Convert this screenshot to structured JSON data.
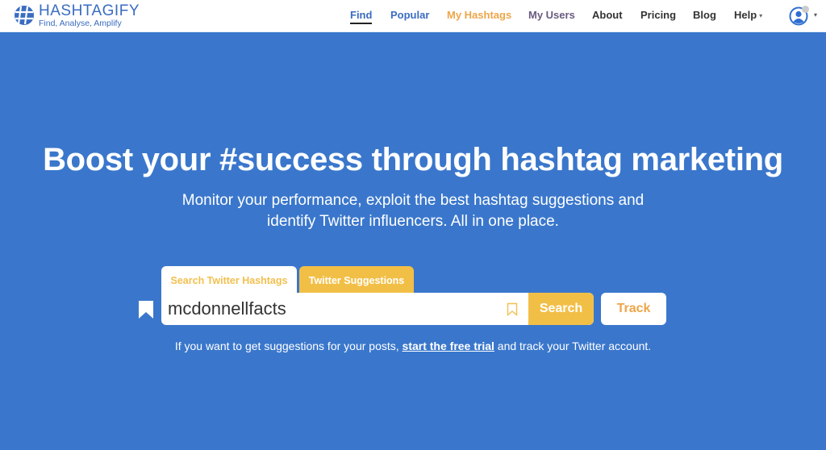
{
  "brand": {
    "name": "HASHTAGIFY",
    "tagline": "Find, Analyse, Amplify",
    "icon": "hashtag-globe-logo-icon",
    "color": "#3a6cc0"
  },
  "nav": {
    "items": [
      {
        "label": "Find",
        "active": true
      },
      {
        "label": "Popular"
      },
      {
        "label": "My Hashtags"
      },
      {
        "label": "My Users"
      },
      {
        "label": "About"
      },
      {
        "label": "Pricing"
      },
      {
        "label": "Blog"
      },
      {
        "label": "Help",
        "dropdown": true
      }
    ],
    "help_caret": "▾",
    "avatar_icon": "user-avatar-icon",
    "avatar_caret": "▾"
  },
  "hero": {
    "title": "Boost your #success through hashtag marketing",
    "subtitle_line1": "Monitor your performance, exploit the best hashtag suggestions and",
    "subtitle_line2": "identify Twitter influencers. All in one place."
  },
  "search": {
    "tabs": [
      {
        "label": "Search Twitter Hashtags",
        "active": true
      },
      {
        "label": "Twitter Suggestions"
      }
    ],
    "input_value": "mcdonnellfacts",
    "search_button": "Search",
    "track_button": "Track"
  },
  "note": {
    "before": "If you want to get suggestions for your posts, ",
    "link": "start the free trial",
    "after": " and track your Twitter account."
  },
  "colors": {
    "background": "#3a77cc",
    "accent": "#f2bf46",
    "orange": "#eea54a"
  }
}
